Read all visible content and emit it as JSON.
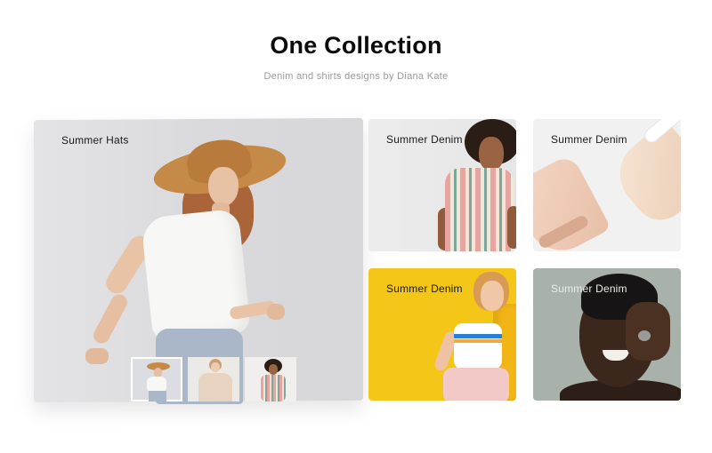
{
  "header": {
    "title": "One Collection",
    "subtitle": "Denim and shirts designs by Diana Kate"
  },
  "featured": {
    "label": "Summer Hats",
    "thumbnails": [
      {
        "name": "woman-in-hat",
        "active": true
      },
      {
        "name": "shirt-model",
        "active": false
      },
      {
        "name": "striped-dress-model",
        "active": false
      }
    ]
  },
  "cards": [
    {
      "label": "Summer Denim"
    },
    {
      "label": "Summer Denim"
    },
    {
      "label": "Summer Denim"
    },
    {
      "label": "Summer Denim"
    }
  ],
  "colors": {
    "accent_yellow": "#f3c617",
    "title": "#0b0b0b",
    "subtitle": "#9a9a9a",
    "card_bg": "#ececec"
  }
}
